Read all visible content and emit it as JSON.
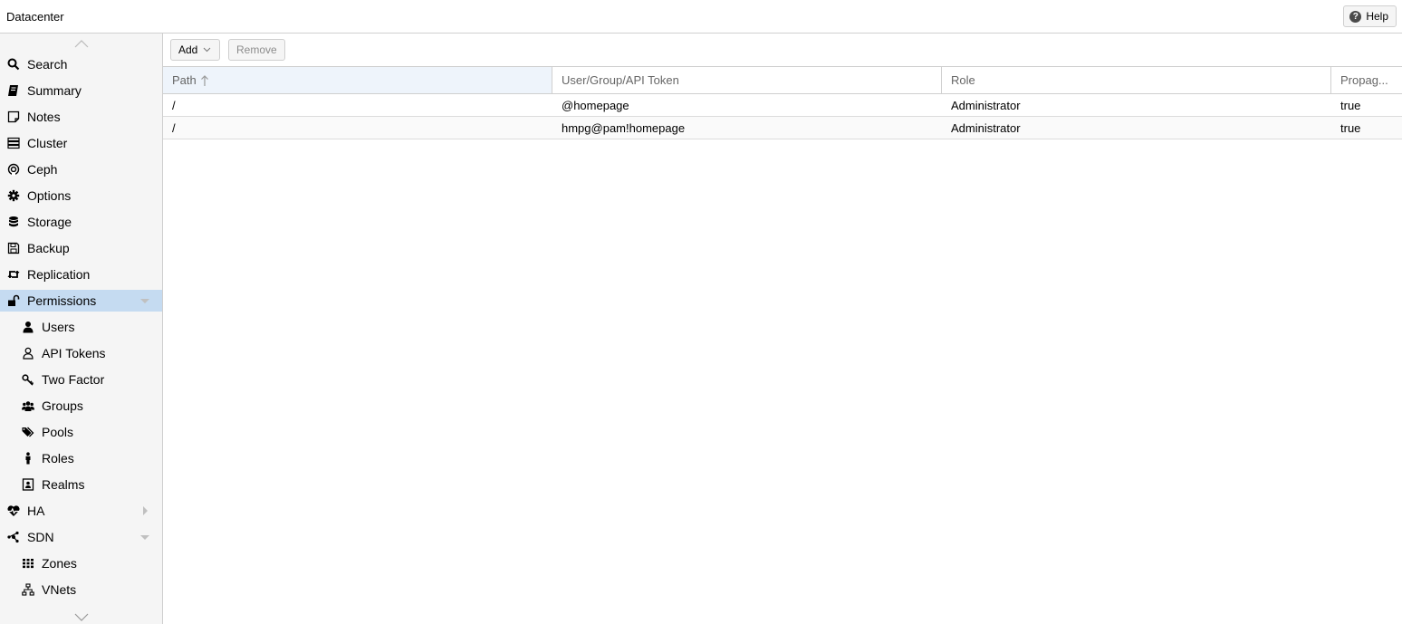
{
  "header": {
    "title": "Datacenter",
    "help_label": "Help"
  },
  "sidebar": {
    "items": [
      {
        "label": "Search",
        "icon": "search-icon"
      },
      {
        "label": "Summary",
        "icon": "book-icon"
      },
      {
        "label": "Notes",
        "icon": "note-icon"
      },
      {
        "label": "Cluster",
        "icon": "server-icon"
      },
      {
        "label": "Ceph",
        "icon": "ceph-icon"
      },
      {
        "label": "Options",
        "icon": "gear-icon"
      },
      {
        "label": "Storage",
        "icon": "database-icon"
      },
      {
        "label": "Backup",
        "icon": "floppy-icon"
      },
      {
        "label": "Replication",
        "icon": "retweet-icon"
      },
      {
        "label": "Permissions",
        "icon": "unlock-icon",
        "selected": true,
        "expanded": true
      },
      {
        "label": "Users",
        "icon": "user-icon"
      },
      {
        "label": "API Tokens",
        "icon": "user-outline-icon"
      },
      {
        "label": "Two Factor",
        "icon": "key-icon"
      },
      {
        "label": "Groups",
        "icon": "users-icon"
      },
      {
        "label": "Pools",
        "icon": "tags-icon"
      },
      {
        "label": "Roles",
        "icon": "male-icon"
      },
      {
        "label": "Realms",
        "icon": "address-book-icon"
      },
      {
        "label": "HA",
        "icon": "heartbeat-icon",
        "expanded": false
      },
      {
        "label": "SDN",
        "icon": "sdn-icon",
        "expanded": true
      },
      {
        "label": "Zones",
        "icon": "grid-icon"
      },
      {
        "label": "VNets",
        "icon": "network-icon"
      }
    ]
  },
  "toolbar": {
    "add_label": "Add",
    "remove_label": "Remove"
  },
  "grid": {
    "columns": [
      "Path",
      "User/Group/API Token",
      "Role",
      "Propag..."
    ],
    "rows": [
      [
        "/",
        "@homepage",
        "Administrator",
        "true"
      ],
      [
        "/",
        "hmpg@pam!homepage",
        "Administrator",
        "true"
      ]
    ]
  }
}
